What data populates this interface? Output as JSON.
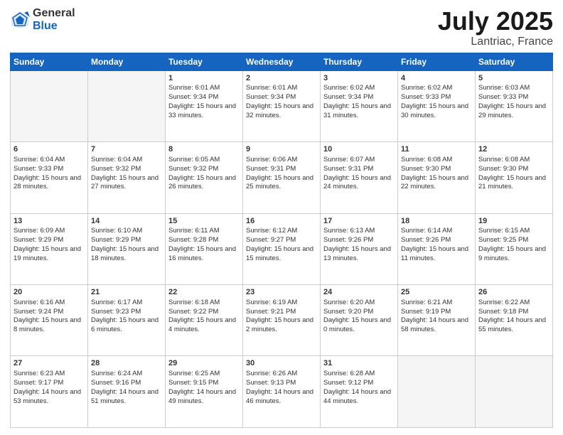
{
  "header": {
    "logo_general": "General",
    "logo_blue": "Blue",
    "title": "July 2025",
    "location": "Lantriac, France"
  },
  "days_header": [
    "Sunday",
    "Monday",
    "Tuesday",
    "Wednesday",
    "Thursday",
    "Friday",
    "Saturday"
  ],
  "weeks": [
    [
      {
        "day": "",
        "sunrise": "",
        "sunset": "",
        "daylight": ""
      },
      {
        "day": "",
        "sunrise": "",
        "sunset": "",
        "daylight": ""
      },
      {
        "day": "1",
        "sunrise": "Sunrise: 6:01 AM",
        "sunset": "Sunset: 9:34 PM",
        "daylight": "Daylight: 15 hours and 33 minutes."
      },
      {
        "day": "2",
        "sunrise": "Sunrise: 6:01 AM",
        "sunset": "Sunset: 9:34 PM",
        "daylight": "Daylight: 15 hours and 32 minutes."
      },
      {
        "day": "3",
        "sunrise": "Sunrise: 6:02 AM",
        "sunset": "Sunset: 9:34 PM",
        "daylight": "Daylight: 15 hours and 31 minutes."
      },
      {
        "day": "4",
        "sunrise": "Sunrise: 6:02 AM",
        "sunset": "Sunset: 9:33 PM",
        "daylight": "Daylight: 15 hours and 30 minutes."
      },
      {
        "day": "5",
        "sunrise": "Sunrise: 6:03 AM",
        "sunset": "Sunset: 9:33 PM",
        "daylight": "Daylight: 15 hours and 29 minutes."
      }
    ],
    [
      {
        "day": "6",
        "sunrise": "Sunrise: 6:04 AM",
        "sunset": "Sunset: 9:33 PM",
        "daylight": "Daylight: 15 hours and 28 minutes."
      },
      {
        "day": "7",
        "sunrise": "Sunrise: 6:04 AM",
        "sunset": "Sunset: 9:32 PM",
        "daylight": "Daylight: 15 hours and 27 minutes."
      },
      {
        "day": "8",
        "sunrise": "Sunrise: 6:05 AM",
        "sunset": "Sunset: 9:32 PM",
        "daylight": "Daylight: 15 hours and 26 minutes."
      },
      {
        "day": "9",
        "sunrise": "Sunrise: 6:06 AM",
        "sunset": "Sunset: 9:31 PM",
        "daylight": "Daylight: 15 hours and 25 minutes."
      },
      {
        "day": "10",
        "sunrise": "Sunrise: 6:07 AM",
        "sunset": "Sunset: 9:31 PM",
        "daylight": "Daylight: 15 hours and 24 minutes."
      },
      {
        "day": "11",
        "sunrise": "Sunrise: 6:08 AM",
        "sunset": "Sunset: 9:30 PM",
        "daylight": "Daylight: 15 hours and 22 minutes."
      },
      {
        "day": "12",
        "sunrise": "Sunrise: 6:08 AM",
        "sunset": "Sunset: 9:30 PM",
        "daylight": "Daylight: 15 hours and 21 minutes."
      }
    ],
    [
      {
        "day": "13",
        "sunrise": "Sunrise: 6:09 AM",
        "sunset": "Sunset: 9:29 PM",
        "daylight": "Daylight: 15 hours and 19 minutes."
      },
      {
        "day": "14",
        "sunrise": "Sunrise: 6:10 AM",
        "sunset": "Sunset: 9:29 PM",
        "daylight": "Daylight: 15 hours and 18 minutes."
      },
      {
        "day": "15",
        "sunrise": "Sunrise: 6:11 AM",
        "sunset": "Sunset: 9:28 PM",
        "daylight": "Daylight: 15 hours and 16 minutes."
      },
      {
        "day": "16",
        "sunrise": "Sunrise: 6:12 AM",
        "sunset": "Sunset: 9:27 PM",
        "daylight": "Daylight: 15 hours and 15 minutes."
      },
      {
        "day": "17",
        "sunrise": "Sunrise: 6:13 AM",
        "sunset": "Sunset: 9:26 PM",
        "daylight": "Daylight: 15 hours and 13 minutes."
      },
      {
        "day": "18",
        "sunrise": "Sunrise: 6:14 AM",
        "sunset": "Sunset: 9:26 PM",
        "daylight": "Daylight: 15 hours and 11 minutes."
      },
      {
        "day": "19",
        "sunrise": "Sunrise: 6:15 AM",
        "sunset": "Sunset: 9:25 PM",
        "daylight": "Daylight: 15 hours and 9 minutes."
      }
    ],
    [
      {
        "day": "20",
        "sunrise": "Sunrise: 6:16 AM",
        "sunset": "Sunset: 9:24 PM",
        "daylight": "Daylight: 15 hours and 8 minutes."
      },
      {
        "day": "21",
        "sunrise": "Sunrise: 6:17 AM",
        "sunset": "Sunset: 9:23 PM",
        "daylight": "Daylight: 15 hours and 6 minutes."
      },
      {
        "day": "22",
        "sunrise": "Sunrise: 6:18 AM",
        "sunset": "Sunset: 9:22 PM",
        "daylight": "Daylight: 15 hours and 4 minutes."
      },
      {
        "day": "23",
        "sunrise": "Sunrise: 6:19 AM",
        "sunset": "Sunset: 9:21 PM",
        "daylight": "Daylight: 15 hours and 2 minutes."
      },
      {
        "day": "24",
        "sunrise": "Sunrise: 6:20 AM",
        "sunset": "Sunset: 9:20 PM",
        "daylight": "Daylight: 15 hours and 0 minutes."
      },
      {
        "day": "25",
        "sunrise": "Sunrise: 6:21 AM",
        "sunset": "Sunset: 9:19 PM",
        "daylight": "Daylight: 14 hours and 58 minutes."
      },
      {
        "day": "26",
        "sunrise": "Sunrise: 6:22 AM",
        "sunset": "Sunset: 9:18 PM",
        "daylight": "Daylight: 14 hours and 55 minutes."
      }
    ],
    [
      {
        "day": "27",
        "sunrise": "Sunrise: 6:23 AM",
        "sunset": "Sunset: 9:17 PM",
        "daylight": "Daylight: 14 hours and 53 minutes."
      },
      {
        "day": "28",
        "sunrise": "Sunrise: 6:24 AM",
        "sunset": "Sunset: 9:16 PM",
        "daylight": "Daylight: 14 hours and 51 minutes."
      },
      {
        "day": "29",
        "sunrise": "Sunrise: 6:25 AM",
        "sunset": "Sunset: 9:15 PM",
        "daylight": "Daylight: 14 hours and 49 minutes."
      },
      {
        "day": "30",
        "sunrise": "Sunrise: 6:26 AM",
        "sunset": "Sunset: 9:13 PM",
        "daylight": "Daylight: 14 hours and 46 minutes."
      },
      {
        "day": "31",
        "sunrise": "Sunrise: 6:28 AM",
        "sunset": "Sunset: 9:12 PM",
        "daylight": "Daylight: 14 hours and 44 minutes."
      },
      {
        "day": "",
        "sunrise": "",
        "sunset": "",
        "daylight": ""
      },
      {
        "day": "",
        "sunrise": "",
        "sunset": "",
        "daylight": ""
      }
    ]
  ]
}
